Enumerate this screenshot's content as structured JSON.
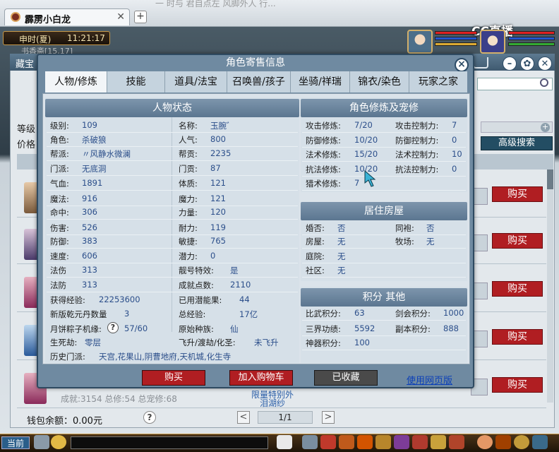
{
  "browser": {
    "tab_title": "霹雳小白龙",
    "tab_close": "✕",
    "new_tab": "+",
    "blurred_text": "一 时与 君自点左 风脚外人 行..."
  },
  "hud": {
    "season": "申时(夏)",
    "time": "11:21:17",
    "sub": "书香斋[15,17]",
    "watermark": "CC直播"
  },
  "background_window": {
    "title": "藏宝",
    "label_level": "等级",
    "label_price": "价格",
    "advanced_search": "高级搜索",
    "buy_label": "购买",
    "row_text_1": "成就:3154 总修:54 总宠修:68",
    "row_link_1": "泪湖纱",
    "row_link_2": "限量特别外"
  },
  "footer": {
    "wallet": "钱包余额：0.00元",
    "help": "?",
    "prev": "<",
    "next": ">",
    "page": "1/1"
  },
  "taskbar": {
    "current_channel": "当前"
  },
  "modal": {
    "title": "角色寄售信息",
    "close": "×",
    "tabs": [
      "人物/修炼",
      "技能",
      "道具/法宝",
      "召唤兽/孩子",
      "坐骑/祥瑞",
      "锦衣/染色",
      "玩家之家"
    ],
    "active_tab": "人物/修炼",
    "status_panel_title": "人物状态",
    "status_left": [
      {
        "label": "级别:",
        "value": "109"
      },
      {
        "label": "角色:",
        "value": "杀破狼"
      },
      {
        "label": "帮派:",
        "value": "〃风静水微澜"
      },
      {
        "label": "门派:",
        "value": "无底洞"
      },
      {
        "label": "气血:",
        "value": "1891"
      },
      {
        "label": "魔法:",
        "value": "916"
      },
      {
        "label": "命中:",
        "value": "306"
      },
      {
        "label": "伤害:",
        "value": "526"
      },
      {
        "label": "防御:",
        "value": "383"
      },
      {
        "label": "速度:",
        "value": "606"
      },
      {
        "label": "法伤",
        "value": "313"
      },
      {
        "label": "法防",
        "value": "313"
      }
    ],
    "status_right": [
      {
        "label": "名称:",
        "value": "玉腕゛"
      },
      {
        "label": "人气:",
        "value": "800"
      },
      {
        "label": "帮贡:",
        "value": "2235"
      },
      {
        "label": "门贡:",
        "value": "87"
      },
      {
        "label": "体质:",
        "value": "121"
      },
      {
        "label": "魔力:",
        "value": "121"
      },
      {
        "label": "力量:",
        "value": "120"
      },
      {
        "label": "耐力:",
        "value": "119"
      },
      {
        "label": "敏捷:",
        "value": "765"
      },
      {
        "label": "潜力:",
        "value": "0"
      },
      {
        "label": "靓号特效:",
        "value": "是"
      },
      {
        "label": "成就点数:",
        "value": "2110"
      }
    ],
    "extra": {
      "exp_label": "获得经验:",
      "exp_value": "22253600",
      "qian_label": "新版乾元丹数量",
      "qian_value": "3",
      "moon_label": "月饼粽子机缘:",
      "moon_q": "?",
      "moon_value": "57/60",
      "life_label": "生死劫:",
      "life_value": "零层",
      "used_label": "已用潜能果:",
      "used_value": "44",
      "total_label": "总经验:",
      "total_value": "17亿",
      "race_label": "原始种族:",
      "race_value": "仙",
      "fly_label": "飞升/渡劫/化圣:",
      "fly_value": "未飞升",
      "history_label": "历史门派:",
      "history_value": "天宫,花果山,阴曹地府,天机城,化生寺"
    },
    "cultivation_title": "角色修炼及宠修",
    "cultivation": [
      {
        "l1": "攻击修炼:",
        "v1": "7/20",
        "l2": "攻击控制力:",
        "v2": "7"
      },
      {
        "l1": "防御修炼:",
        "v1": "10/20",
        "l2": "防御控制力:",
        "v2": "0"
      },
      {
        "l1": "法术修炼:",
        "v1": "15/20",
        "l2": "法术控制力:",
        "v2": "10"
      },
      {
        "l1": "抗法修炼:",
        "v1": "10/20",
        "l2": "抗法控制力:",
        "v2": "0"
      },
      {
        "l1": "猎术修炼:",
        "v1": "7",
        "l2": "",
        "v2": ""
      }
    ],
    "house_title": "居住房屋",
    "house": [
      {
        "l1": "婚否:",
        "v1": "否",
        "l2": "同袍:",
        "v2": "否"
      },
      {
        "l1": "房屋:",
        "v1": "无",
        "l2": "牧场:",
        "v2": "无"
      },
      {
        "l1": "庭院:",
        "v1": "无",
        "l2": "",
        "v2": ""
      },
      {
        "l1": "社区:",
        "v1": "无",
        "l2": "",
        "v2": ""
      }
    ],
    "score_title": "积分 其他",
    "score": [
      {
        "l1": "比武积分:",
        "v1": "63",
        "l2": "剑会积分:",
        "v2": "1000"
      },
      {
        "l1": "三界功绩:",
        "v1": "5592",
        "l2": "副本积分:",
        "v2": "888"
      },
      {
        "l1": "神器积分:",
        "v1": "100",
        "l2": "",
        "v2": ""
      }
    ],
    "buttons": {
      "buy": "购买",
      "add_cart": "加入购物车",
      "favorited": "已收藏",
      "web_version": "使用网页版"
    }
  },
  "colors": {
    "buy_red": "#b01e22",
    "modal_blue": "#6f8aa1",
    "value_blue": "#2b4e8a",
    "favorited_gray": "#4a4a4a"
  }
}
